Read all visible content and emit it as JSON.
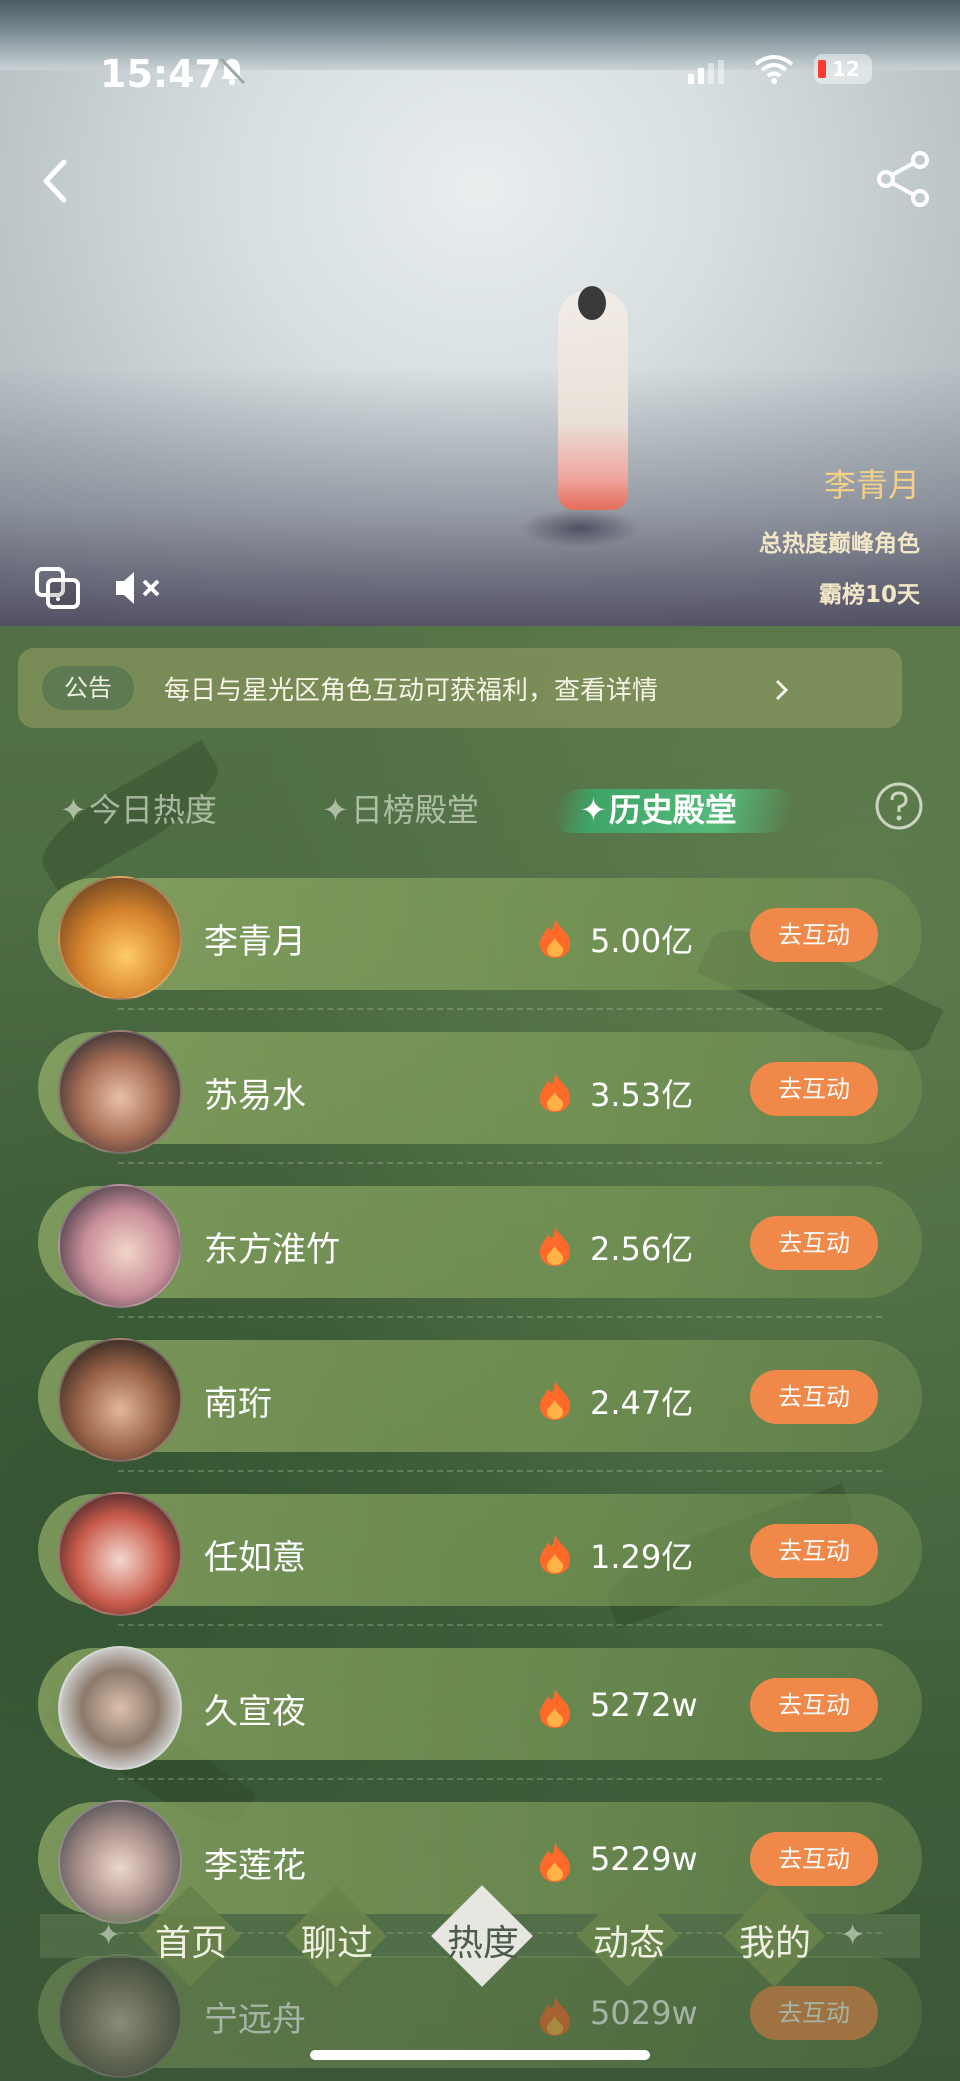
{
  "status_bar": {
    "time": "15:47",
    "battery": "12"
  },
  "hero": {
    "character_name": "李青月",
    "line1": "总热度巅峰角色",
    "line2": "霸榜10天"
  },
  "notice": {
    "tag": "公告",
    "text": "每日与星光区角色互动可获福利，查看详情"
  },
  "tabs": [
    {
      "label": "今日热度",
      "active": false
    },
    {
      "label": "日榜殿堂",
      "active": false
    },
    {
      "label": "历史殿堂",
      "active": true
    }
  ],
  "ranking": [
    {
      "name": "李青月",
      "heat": "5.00亿",
      "action": "去互动"
    },
    {
      "name": "苏易水",
      "heat": "3.53亿",
      "action": "去互动"
    },
    {
      "name": "东方淮竹",
      "heat": "2.56亿",
      "action": "去互动"
    },
    {
      "name": "南珩",
      "heat": "2.47亿",
      "action": "去互动"
    },
    {
      "name": "任如意",
      "heat": "1.29亿",
      "action": "去互动"
    },
    {
      "name": "久宣夜",
      "heat": "5272w",
      "action": "去互动"
    },
    {
      "name": "李莲花",
      "heat": "5229w",
      "action": "去互动"
    },
    {
      "name": "宁远舟",
      "heat": "5029w",
      "action": "去互动"
    }
  ],
  "bottom_nav": [
    {
      "label": "首页",
      "active": false
    },
    {
      "label": "聊过",
      "active": false
    },
    {
      "label": "热度",
      "active": true
    },
    {
      "label": "动态",
      "active": false
    },
    {
      "label": "我的",
      "active": false
    }
  ],
  "colors": {
    "accent_button": "#f0884a",
    "hero_name": "#f4cf86",
    "background_green": "#4b6b42"
  }
}
